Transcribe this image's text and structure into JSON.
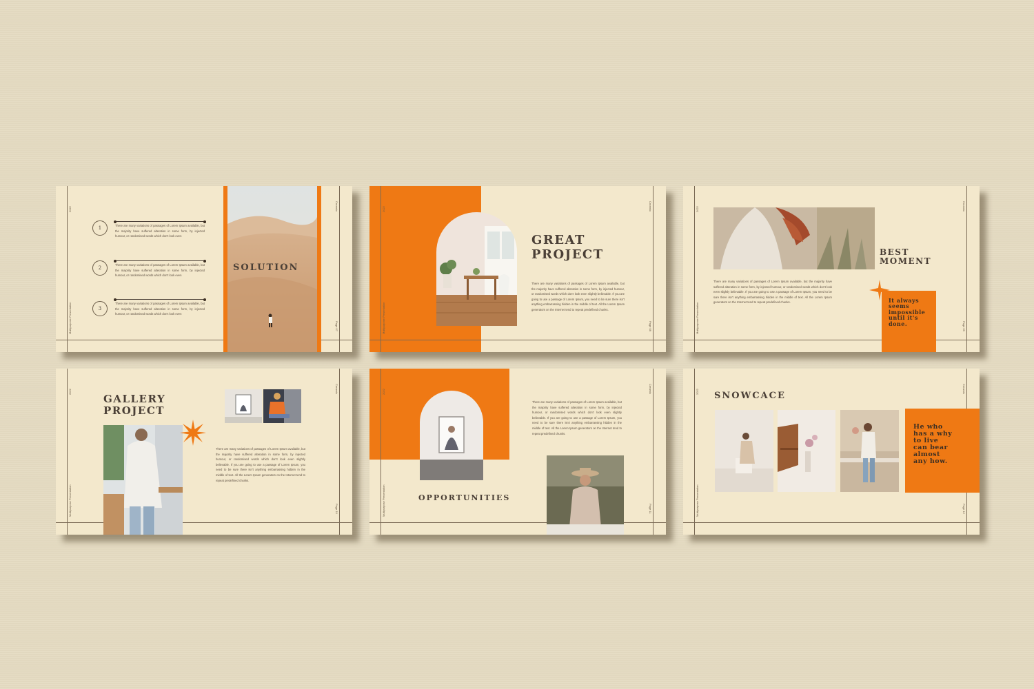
{
  "colors": {
    "background": "#e5dbc2",
    "slide": "#f3e8cc",
    "accent": "#ef7914",
    "ink": "#4a3f36"
  },
  "common": {
    "year": "2022",
    "brand": "Creamix",
    "presentation": "Multipurpose Presentation",
    "body_text": "There are many variations of passages of Lorem Ipsum available, but the majority have suffered alteration in some form, by injected humour, or randomised words which don't look even slightly believable. If you are going to use a passage of Lorem Ipsum, you need to be sure there isn't anything embarrassing hidden in the middle of text. All the Lorem Ipsum generators on the Internet tend to repeat predefined chunks.",
    "short_text": "There are many variations of passages of Lorem Ipsum available, but the majority have suffered alteration in some form, by injected humour, or randomised words which don't look even"
  },
  "slides": [
    {
      "title": "SOLUTION",
      "page": "Page 07",
      "items": [
        {
          "num": "1"
        },
        {
          "num": "2"
        },
        {
          "num": "3"
        }
      ]
    },
    {
      "title_line1": "GREAT",
      "title_line2": "PROJECT",
      "page": "Page 08"
    },
    {
      "title_line1": "BEST",
      "title_line2": "MOMENT",
      "page": "Page 09",
      "quote": "It always seems impossible until it's done."
    },
    {
      "title_line1": "GALLERY",
      "title_line2": "PROJECT",
      "page": "Page 10"
    },
    {
      "title": "OPPORTUNITIES",
      "page": "Page 11"
    },
    {
      "title": "SNOWCACE",
      "page": "Page 12",
      "quote": "He who has a why to live can bear almost any how."
    }
  ]
}
